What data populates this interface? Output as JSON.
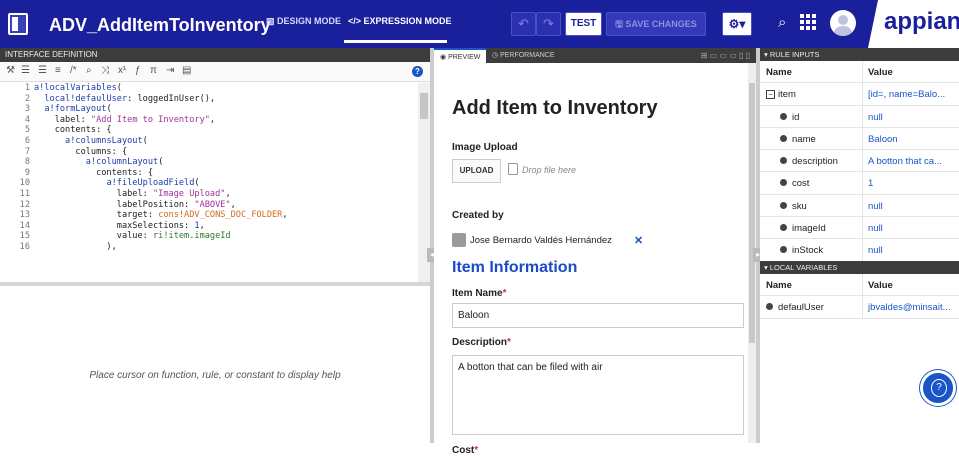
{
  "header": {
    "title": "ADV_AddItemToInventory",
    "design_mode": "DESIGN MODE",
    "expression_mode": "EXPRESSION MODE",
    "test": "TEST",
    "save_changes": "SAVE CHANGES",
    "brand": "appian"
  },
  "editor": {
    "panel_title": "INTERFACE DEFINITION",
    "help_text": "Place cursor on function, rule, or constant to display help",
    "lines": [
      {
        "n": "1",
        "text": "a!localVariables("
      },
      {
        "n": "2",
        "text": "  local!defaulUser: loggedInUser(),"
      },
      {
        "n": "3",
        "text": "  a!formLayout("
      },
      {
        "n": "4",
        "text": "    label: \"Add Item to Inventory\","
      },
      {
        "n": "5",
        "text": "    contents: {"
      },
      {
        "n": "6",
        "text": "      a!columnsLayout("
      },
      {
        "n": "7",
        "text": "        columns: {"
      },
      {
        "n": "8",
        "text": "          a!columnLayout("
      },
      {
        "n": "9",
        "text": "            contents: {"
      },
      {
        "n": "10",
        "text": "              a!fileUploadField("
      },
      {
        "n": "11",
        "text": "                label: \"Image Upload\","
      },
      {
        "n": "12",
        "text": "                labelPosition: \"ABOVE\","
      },
      {
        "n": "13",
        "text": "                target: cons!ADV_CONS_DOC_FOLDER,"
      },
      {
        "n": "14",
        "text": "                maxSelections: 1,"
      },
      {
        "n": "15",
        "text": "                value: ri!item.imageId"
      },
      {
        "n": "16",
        "text": "              ),"
      }
    ]
  },
  "preview": {
    "tab_preview": "PREVIEW",
    "tab_performance": "PERFORMANCE",
    "form_title": "Add Item to Inventory",
    "image_upload_label": "Image Upload",
    "upload_button": "UPLOAD",
    "drop_text": "Drop file here",
    "created_by_label": "Created by",
    "created_by_user": "Jose Bernardo Valdés Hernández",
    "section_title": "Item Information",
    "item_name_label": "Item Name",
    "item_name_value": "Baloon",
    "description_label": "Description",
    "description_value": "A botton that can be  filed with air",
    "cost_label": "Cost",
    "required_marker": "*"
  },
  "rule_inputs": {
    "title": "RULE INPUTS",
    "col_name": "Name",
    "col_value": "Value",
    "rows": [
      {
        "name": "item",
        "value": "[id=, name=Balo..."
      },
      {
        "name": "id",
        "value": "null"
      },
      {
        "name": "name",
        "value": "Baloon"
      },
      {
        "name": "description",
        "value": "A botton that ca..."
      },
      {
        "name": "cost",
        "value": "1"
      },
      {
        "name": "sku",
        "value": "null"
      },
      {
        "name": "imageId",
        "value": "null"
      },
      {
        "name": "inStock",
        "value": "null"
      }
    ]
  },
  "local_variables": {
    "title": "LOCAL VARIABLES",
    "col_name": "Name",
    "col_value": "Value",
    "rows": [
      {
        "name": "defaulUser",
        "value": "jbvaldes@minsait..."
      }
    ]
  },
  "colors": {
    "header_bg": "#1a1f9c",
    "accent": "#1a55c8",
    "required": "#c0392b"
  }
}
